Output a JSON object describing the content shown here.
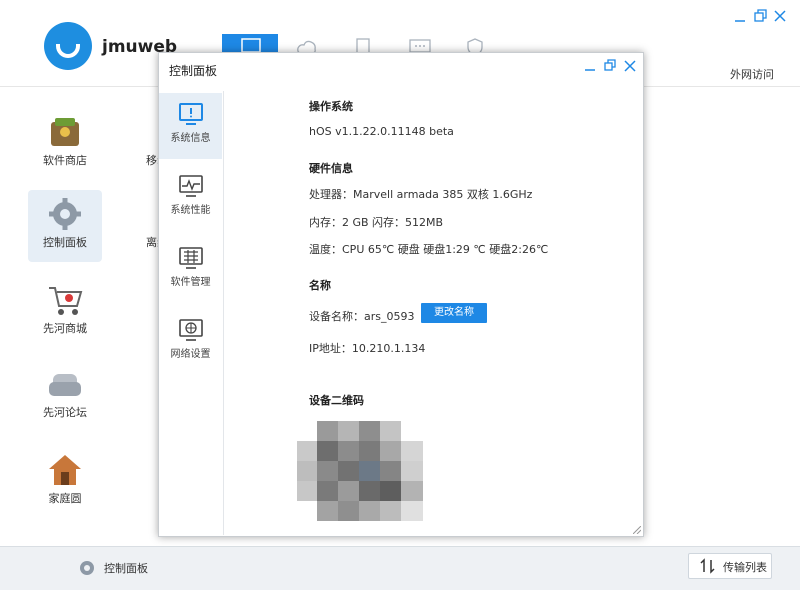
{
  "app": {
    "name": "jmuweb",
    "outside_link": "外网访问"
  },
  "apps": [
    {
      "label": "软件商店",
      "icon": "software-store-icon"
    },
    {
      "label": "控制面板",
      "icon": "control-panel-gear-icon"
    },
    {
      "label": "先河商城",
      "icon": "shopping-cart-icon"
    },
    {
      "label": "先河论坛",
      "icon": "forum-sofa-icon"
    },
    {
      "label": "家庭圆",
      "icon": "home-icon"
    },
    {
      "label": "移动",
      "icon": "mobile-icon"
    },
    {
      "label": "离线",
      "icon": "offline-icon"
    }
  ],
  "taskbar": {
    "item_label": "控制面板",
    "transfer_label": "传输列表"
  },
  "dialog": {
    "title": "控制面板",
    "nav": [
      {
        "label": "系统信息",
        "icon": "monitor-info-icon"
      },
      {
        "label": "系统性能",
        "icon": "performance-chart-icon"
      },
      {
        "label": "软件管理",
        "icon": "grid-apps-icon"
      },
      {
        "label": "网络设置",
        "icon": "network-globe-icon"
      }
    ],
    "sections": {
      "os_title": "操作系统",
      "os_version": "hOS v1.1.22.0.11148 beta",
      "hw_title": "硬件信息",
      "cpu": "处理器：Marvell armada 385 双核 1.6GHz",
      "memory": "内存：2 GB 闪存：512MB",
      "temp": "温度：CPU 65℃ 硬盘 硬盘1:29 ℃ 硬盘2:26℃",
      "name_title": "名称",
      "device_name": "设备名称：ars_0593",
      "rename_button": "更改名称",
      "ip": "IP地址：10.210.1.134",
      "qr_title": "设备二维码"
    }
  },
  "colors": {
    "accent": "#1e88e5",
    "selected_bg": "#e6eef6"
  }
}
